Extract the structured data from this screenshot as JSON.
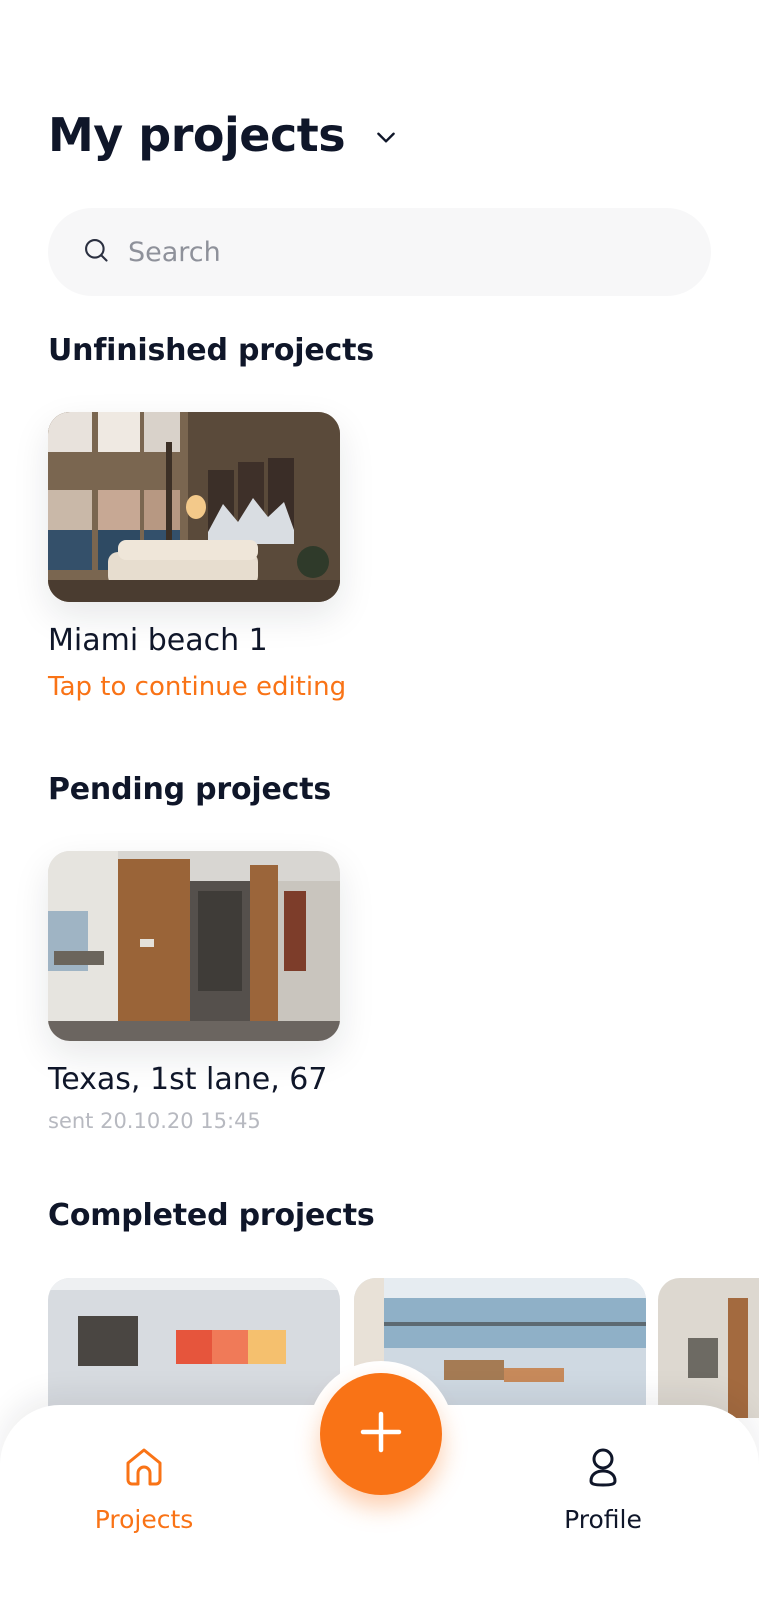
{
  "header": {
    "title": "My projects"
  },
  "search": {
    "placeholder": "Search"
  },
  "sections": {
    "unfinished": {
      "title": "Unfinished projects",
      "project": {
        "name": "Miami beach 1",
        "subtitle": "Tap to continue editing"
      }
    },
    "pending": {
      "title": "Pending projects",
      "project": {
        "name": "Texas, 1st lane, 67",
        "subtitle": "sent 20.10.20 15:45"
      }
    },
    "completed": {
      "title": "Completed projects"
    }
  },
  "nav": {
    "projects_label": "Projects",
    "profile_label": "Profile"
  },
  "colors": {
    "accent": "#f97316",
    "text": "#0f1629",
    "muted": "#b7b9c0",
    "search_bg": "#f7f7f8"
  },
  "icons": {
    "title_dropdown": "chevron-down-icon",
    "search": "search-icon",
    "projects_tab": "home-icon",
    "profile_tab": "user-icon",
    "add": "plus-icon"
  }
}
